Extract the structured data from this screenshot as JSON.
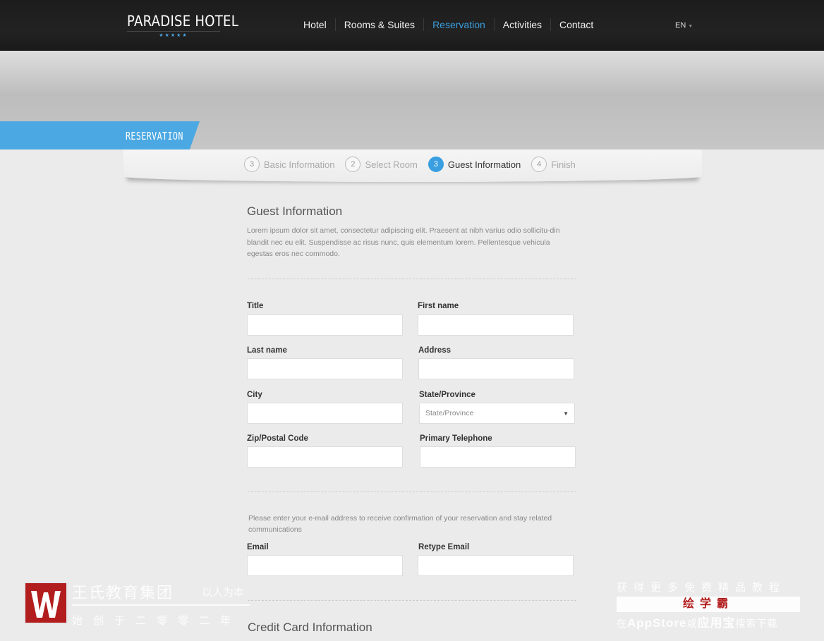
{
  "header": {
    "logo_text": "PARADISE HOTEL",
    "logo_stars": "★★★★★",
    "nav": [
      {
        "label": "Hotel"
      },
      {
        "label": "Rooms & Suites"
      },
      {
        "label": "Reservation"
      },
      {
        "label": "Activities"
      },
      {
        "label": "Contact"
      }
    ],
    "active_nav": "Reservation",
    "language": "EN"
  },
  "banner": {
    "label": "RESERVATION"
  },
  "steps": [
    {
      "num": "3",
      "label": "Basic Information"
    },
    {
      "num": "2",
      "label": "Select Room"
    },
    {
      "num": "3",
      "label": "Guest Information"
    },
    {
      "num": "4",
      "label": "Finish"
    }
  ],
  "active_step": "Guest Information",
  "guest": {
    "title": "Guest Information",
    "description": "Lorem ipsum dolor sit amet, consectetur adipiscing elit. Praesent at nibh varius odio sollicitu-din blandit nec eu elit. Suspendisse ac risus nunc, quis elementum lorem. Pellentesque vehicula egestas eros nec commodo.",
    "fields": {
      "title": {
        "label": "Title",
        "value": ""
      },
      "first_name": {
        "label": "First name",
        "value": ""
      },
      "last_name": {
        "label": "Last name",
        "value": ""
      },
      "address": {
        "label": "Address",
        "value": ""
      },
      "city": {
        "label": "City",
        "value": ""
      },
      "state": {
        "label": "State/Province",
        "placeholder": "State/Province"
      },
      "zip": {
        "label": "Zip/Postal Code",
        "value": ""
      },
      "phone": {
        "label": "Primary Telephone",
        "value": ""
      }
    }
  },
  "email_section": {
    "note": "Please enter your e-mail address to receive confirmation of your reservation and stay related communications",
    "email": {
      "label": "Email",
      "value": ""
    },
    "retype": {
      "label": "Retype Email",
      "value": ""
    }
  },
  "credit": {
    "title": "Credit Card Information"
  },
  "watermark_left": {
    "brand": "王氏教育集团",
    "motto": "以人为本",
    "sub": "始创于二零零二年"
  },
  "watermark_right": {
    "line1": "获得更多免费精品教程",
    "line2": "绘学霸",
    "line3_prefix": "在",
    "line3_store": "AppStore",
    "line3_mid": "或",
    "line3_app": "应用宝",
    "line3_suffix": "搜索下载"
  },
  "colors": {
    "accent": "#3a9fe0",
    "ribbon": "#4ba8e2",
    "navbar": "#1e1e1e",
    "watermark_red": "#b21d1d"
  }
}
